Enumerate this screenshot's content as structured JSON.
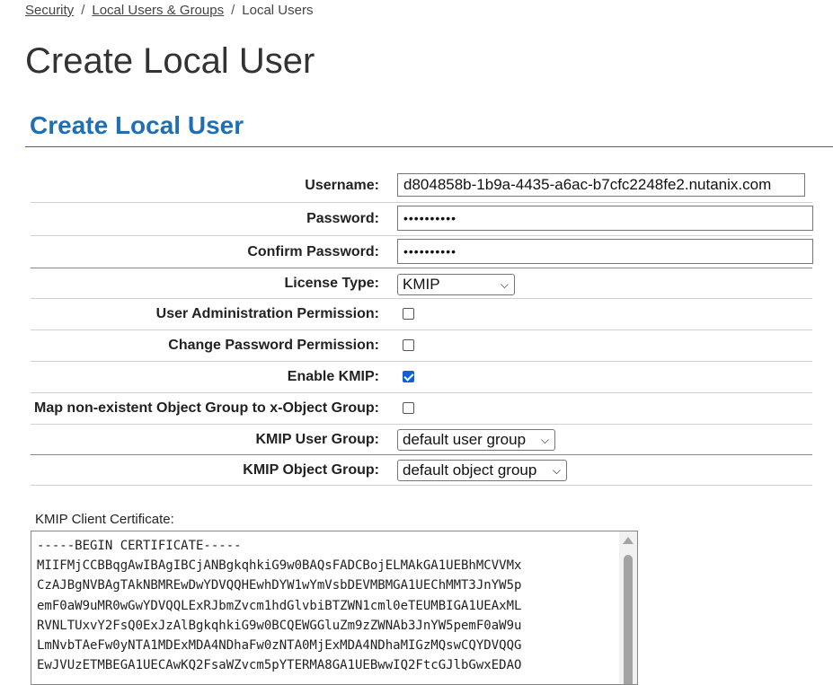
{
  "breadcrumb": {
    "items": [
      "Security",
      "Local Users & Groups",
      "Local Users"
    ],
    "separator": "/"
  },
  "page_title": "Create Local User",
  "section_title": "Create Local User",
  "form": {
    "username": {
      "label": "Username:",
      "value": "d804858b-1b9a-4435-a6ac-b7cfc2248fe2.nutanix.com"
    },
    "password": {
      "label": "Password:",
      "value": "••••••••••"
    },
    "confirm_password": {
      "label": "Confirm Password:",
      "value": "••••••••••"
    },
    "license_type": {
      "label": "License Type:",
      "value": "KMIP"
    },
    "user_admin_permission": {
      "label": "User Administration Permission:",
      "checked": false
    },
    "change_password_permission": {
      "label": "Change Password Permission:",
      "checked": false
    },
    "enable_kmip": {
      "label": "Enable KMIP:",
      "checked": true
    },
    "map_object_group": {
      "label": "Map non-existent Object Group to x-Object Group:",
      "checked": false
    },
    "kmip_user_group": {
      "label": "KMIP User Group:",
      "value": "default user group"
    },
    "kmip_object_group": {
      "label": "KMIP Object Group:",
      "value": "default object group"
    }
  },
  "certificate": {
    "label": "KMIP Client Certificate:",
    "text": "-----BEGIN CERTIFICATE-----\nMIIFMjCCBBqgAwIBAgIBCjANBgkqhkiG9w0BAQsFADCBojELMAkGA1UEBhMCVVMx\nCzAJBgNVBAgTAkNBMREwDwYDVQQHEwhDYW1wYmVsbDEVMBMGA1UEChMMT3JnYW5p\nemF0aW9uMR0wGwYDVQQLExRJbmZvcm1hdGlvbiBTZWN1cml0eTEUMBIGA1UEAxML\nRVNLTUxvY2FsQ0ExJzAlBgkqhkiG9w0BCQEWGGluZm9zZWNAb3JnYW5pemF0aW9u\nLmNvbTAeFw0yNTA1MDExMDA4NDhaFw0zNTA0MjExMDA4NDhaMIGzMQswCQYDVQQG\nEwJVUzETMBEGA1UECAwKQ2FsaWZvcm5pYTERMA8GA1UEBwwIQ2FtcGJlbGwxEDAO"
  },
  "colors": {
    "accent": "#1f6fb2",
    "checkbox_checked": "#0b63d6"
  }
}
